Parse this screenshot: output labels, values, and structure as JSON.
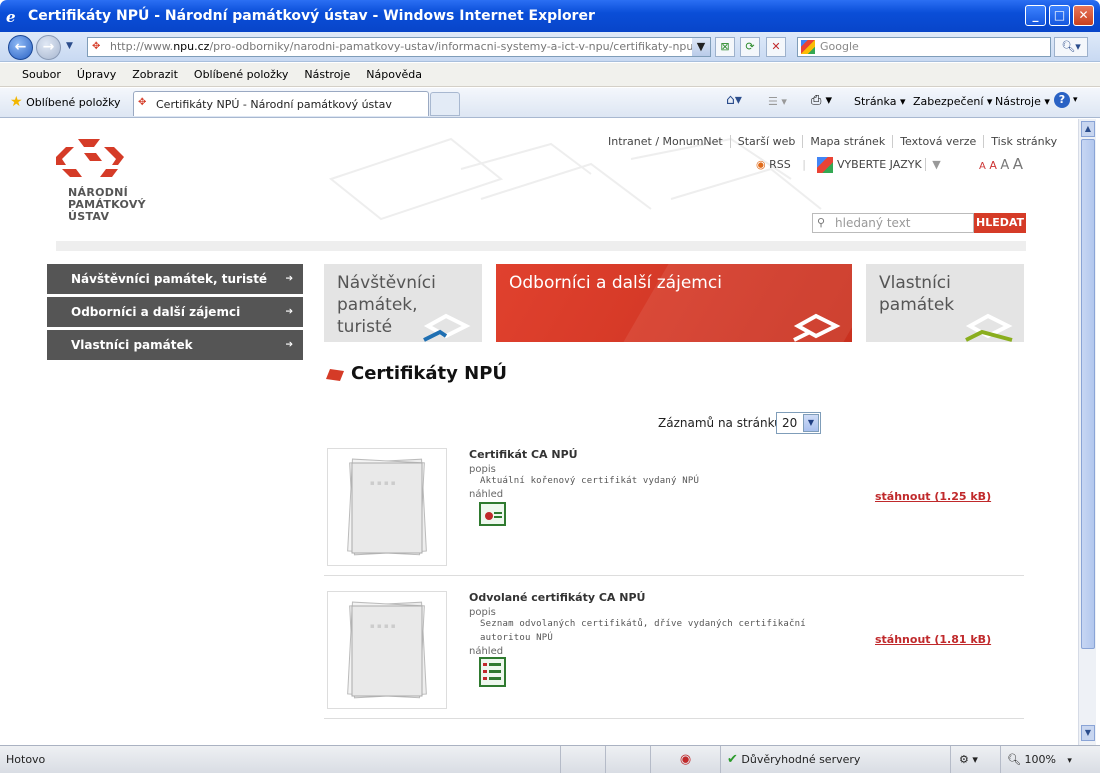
{
  "window": {
    "title": "Certifikáty NPÚ - Národní památkový ústav - Windows Internet Explorer"
  },
  "address": {
    "url_prefix": "http://www.",
    "url_domain": "npu.cz",
    "url_path": "/pro-odborniky/narodni-pamatkovy-ustav/informacni-systemy-a-ict-v-npu/certifikaty-npu/gallery/",
    "search_placeholder": "Google"
  },
  "menu": [
    "Soubor",
    "Úpravy",
    "Zobrazit",
    "Oblíbené položky",
    "Nástroje",
    "Nápověda"
  ],
  "favorites": {
    "label": "Oblíbené položky",
    "tab_title": "Certifikáty NPÚ - Národní památkový ústav",
    "page_menu": "Stránka",
    "security_menu": "Zabezpečení",
    "tools_menu": "Nástroje"
  },
  "site": {
    "logo": [
      "NÁRODNÍ",
      "PAMÁTKOVÝ",
      "ÚSTAV"
    ],
    "toplinks": [
      "Intranet / MonumNet",
      "Starší web",
      "Mapa stránek",
      "Textová verze",
      "Tisk stránky"
    ],
    "rss": "RSS",
    "language": "VYBERTE JAZYK",
    "font_sizes": [
      "A",
      "A",
      "A",
      "A"
    ],
    "search_placeholder": "hledaný text",
    "search_button": "HLEDAT"
  },
  "left_menu": [
    "Návštěvníci památek, turisté",
    "Odborníci a další zájemci",
    "Vlastníci památek"
  ],
  "banners": [
    {
      "label": "Návštěvníci památek, turisté",
      "accent": "#1f6fb2"
    },
    {
      "label": "Odborníci a další zájemci",
      "accent": "#ffffff"
    },
    {
      "label": "Vlastníci památek",
      "accent": "#8aae1e"
    }
  ],
  "content": {
    "heading": "Certifikáty NPÚ",
    "per_page_label": "Záznamů na stránku:",
    "per_page_value": "20",
    "items": [
      {
        "title": "Certifikát CA NPÚ",
        "popis_label": "popis",
        "description": "Aktuální kořenový certifikát vydaný NPÚ",
        "preview_label": "náhled",
        "download": "stáhnout (1.25 kB)"
      },
      {
        "title": "Odvolané certifikáty CA NPÚ",
        "popis_label": "popis",
        "description": "Seznam odvolaných certifikátů, dříve vydaných certifikační autoritou NPÚ",
        "preview_label": "náhled",
        "download": "stáhnout (1.81 kB)"
      }
    ]
  },
  "status": {
    "text": "Hotovo",
    "zone": "Důvěryhodné servery",
    "zoom": "100%"
  },
  "colors": {
    "brand_red": "#d53b27",
    "menu_gray": "#555555",
    "ie_blue": "#0a4ed8"
  }
}
